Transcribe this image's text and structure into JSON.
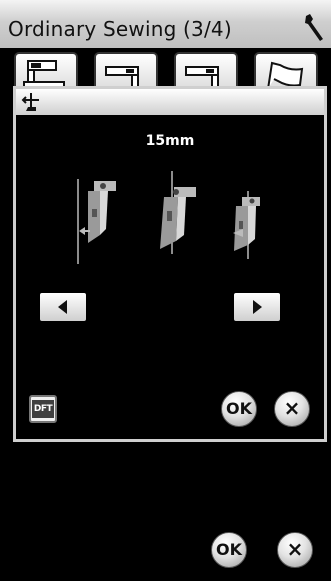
{
  "header": {
    "title": "Ordinary Sewing (3/4)",
    "settings_icon": "wrench-icon"
  },
  "tabs": [
    {
      "icon": "sewing-machine-icon",
      "selected": true
    },
    {
      "icon": "machine-side-icon",
      "selected": false
    },
    {
      "icon": "machine-side-icon",
      "selected": false
    },
    {
      "icon": "flag-icon",
      "selected": false
    }
  ],
  "dialog": {
    "header_icon": "presser-foot-icon",
    "value": "15mm",
    "left_button_icon": "arrow-left-icon",
    "right_button_icon": "arrow-right-icon",
    "default_label": "DFT",
    "ok_label": "OK",
    "cancel_label": "×"
  },
  "footer": {
    "ok_label": "OK",
    "cancel_label": "×"
  }
}
